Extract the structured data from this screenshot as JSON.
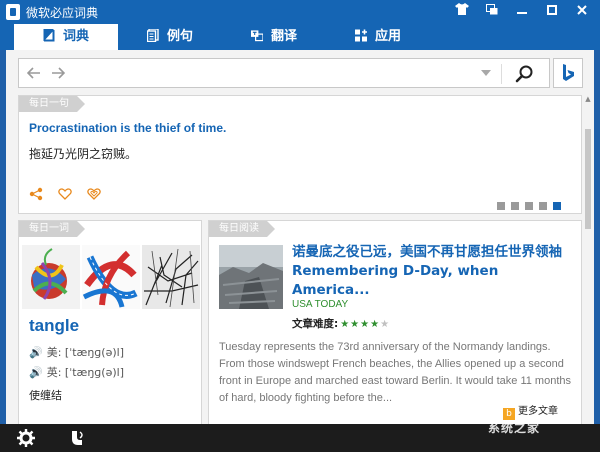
{
  "window": {
    "title": "微软必应词典",
    "buttons": [
      "shirt-icon",
      "restore-window-icon",
      "minimize-icon",
      "maximize-icon",
      "close-icon"
    ]
  },
  "tabs": [
    {
      "label": "词典",
      "icon": "book-icon",
      "active": true
    },
    {
      "label": "例句",
      "icon": "document-icon",
      "active": false
    },
    {
      "label": "翻译",
      "icon": "translate-icon",
      "active": false
    },
    {
      "label": "应用",
      "icon": "apps-icon",
      "active": false
    }
  ],
  "search": {
    "value": "",
    "placeholder": ""
  },
  "daily_sentence": {
    "label": "每日一句",
    "english": "Procrastination is the thief of time.",
    "chinese": "拖延乃光阴之窃贼。",
    "pages": 5,
    "current_page": 5
  },
  "daily_word": {
    "label": "每日一词",
    "word": "tangle",
    "pron_us": "美: [ˈtæŋɡ(ə)l]",
    "pron_uk": "英: [ˈtæŋɡ(ə)l]",
    "definition": "使缠结"
  },
  "daily_reading": {
    "label": "每日阅读",
    "title": "诺曼底之役已远，美国不再甘愿担任世界领袖  Remembering D-Day, when America...",
    "source": "USA TODAY",
    "difficulty_label": "文章难度:",
    "difficulty_stars": 4,
    "difficulty_max": 5,
    "excerpt": "Tuesday represents the 73rd anniversary of the Normandy landings. From those windswept French beaches, the Allies opened up a second front in Europe and marched east toward Berlin. It would take 11 months of hard, bloody fighting before the...",
    "more_label": "更多文章"
  },
  "bottombar": {
    "icons": [
      "gear-icon",
      "microphone-icon"
    ]
  },
  "watermark": "系统之家",
  "colors": {
    "brand": "#1565b4",
    "accent": "#e8891d",
    "source": "#2f8f2f"
  }
}
